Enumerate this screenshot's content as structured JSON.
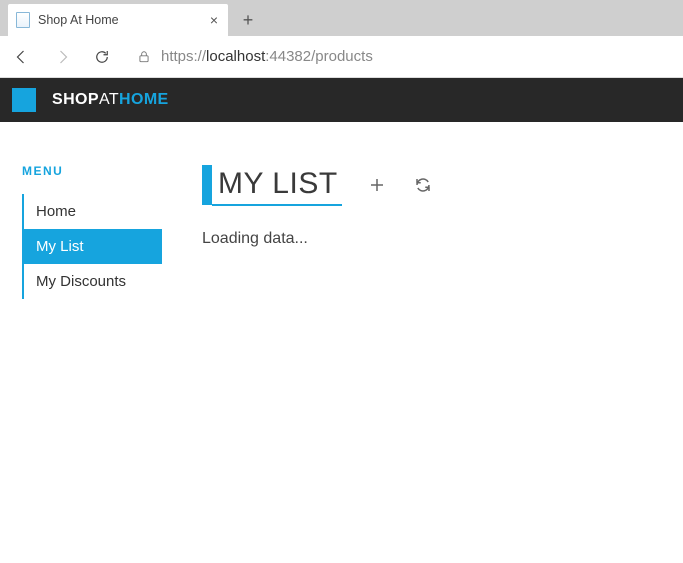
{
  "browser": {
    "tab_title": "Shop At Home",
    "url_html": "https://<span class='dark'>localhost</span>:44382/products"
  },
  "brand": {
    "part1": "SHOP",
    "part2": "AT",
    "part3": "HOME"
  },
  "sidebar": {
    "label": "MENU",
    "items": [
      {
        "label": "Home"
      },
      {
        "label": "My List"
      },
      {
        "label": "My Discounts"
      }
    ],
    "active_index": 1
  },
  "main": {
    "title": "MY LIST",
    "status": "Loading data..."
  }
}
